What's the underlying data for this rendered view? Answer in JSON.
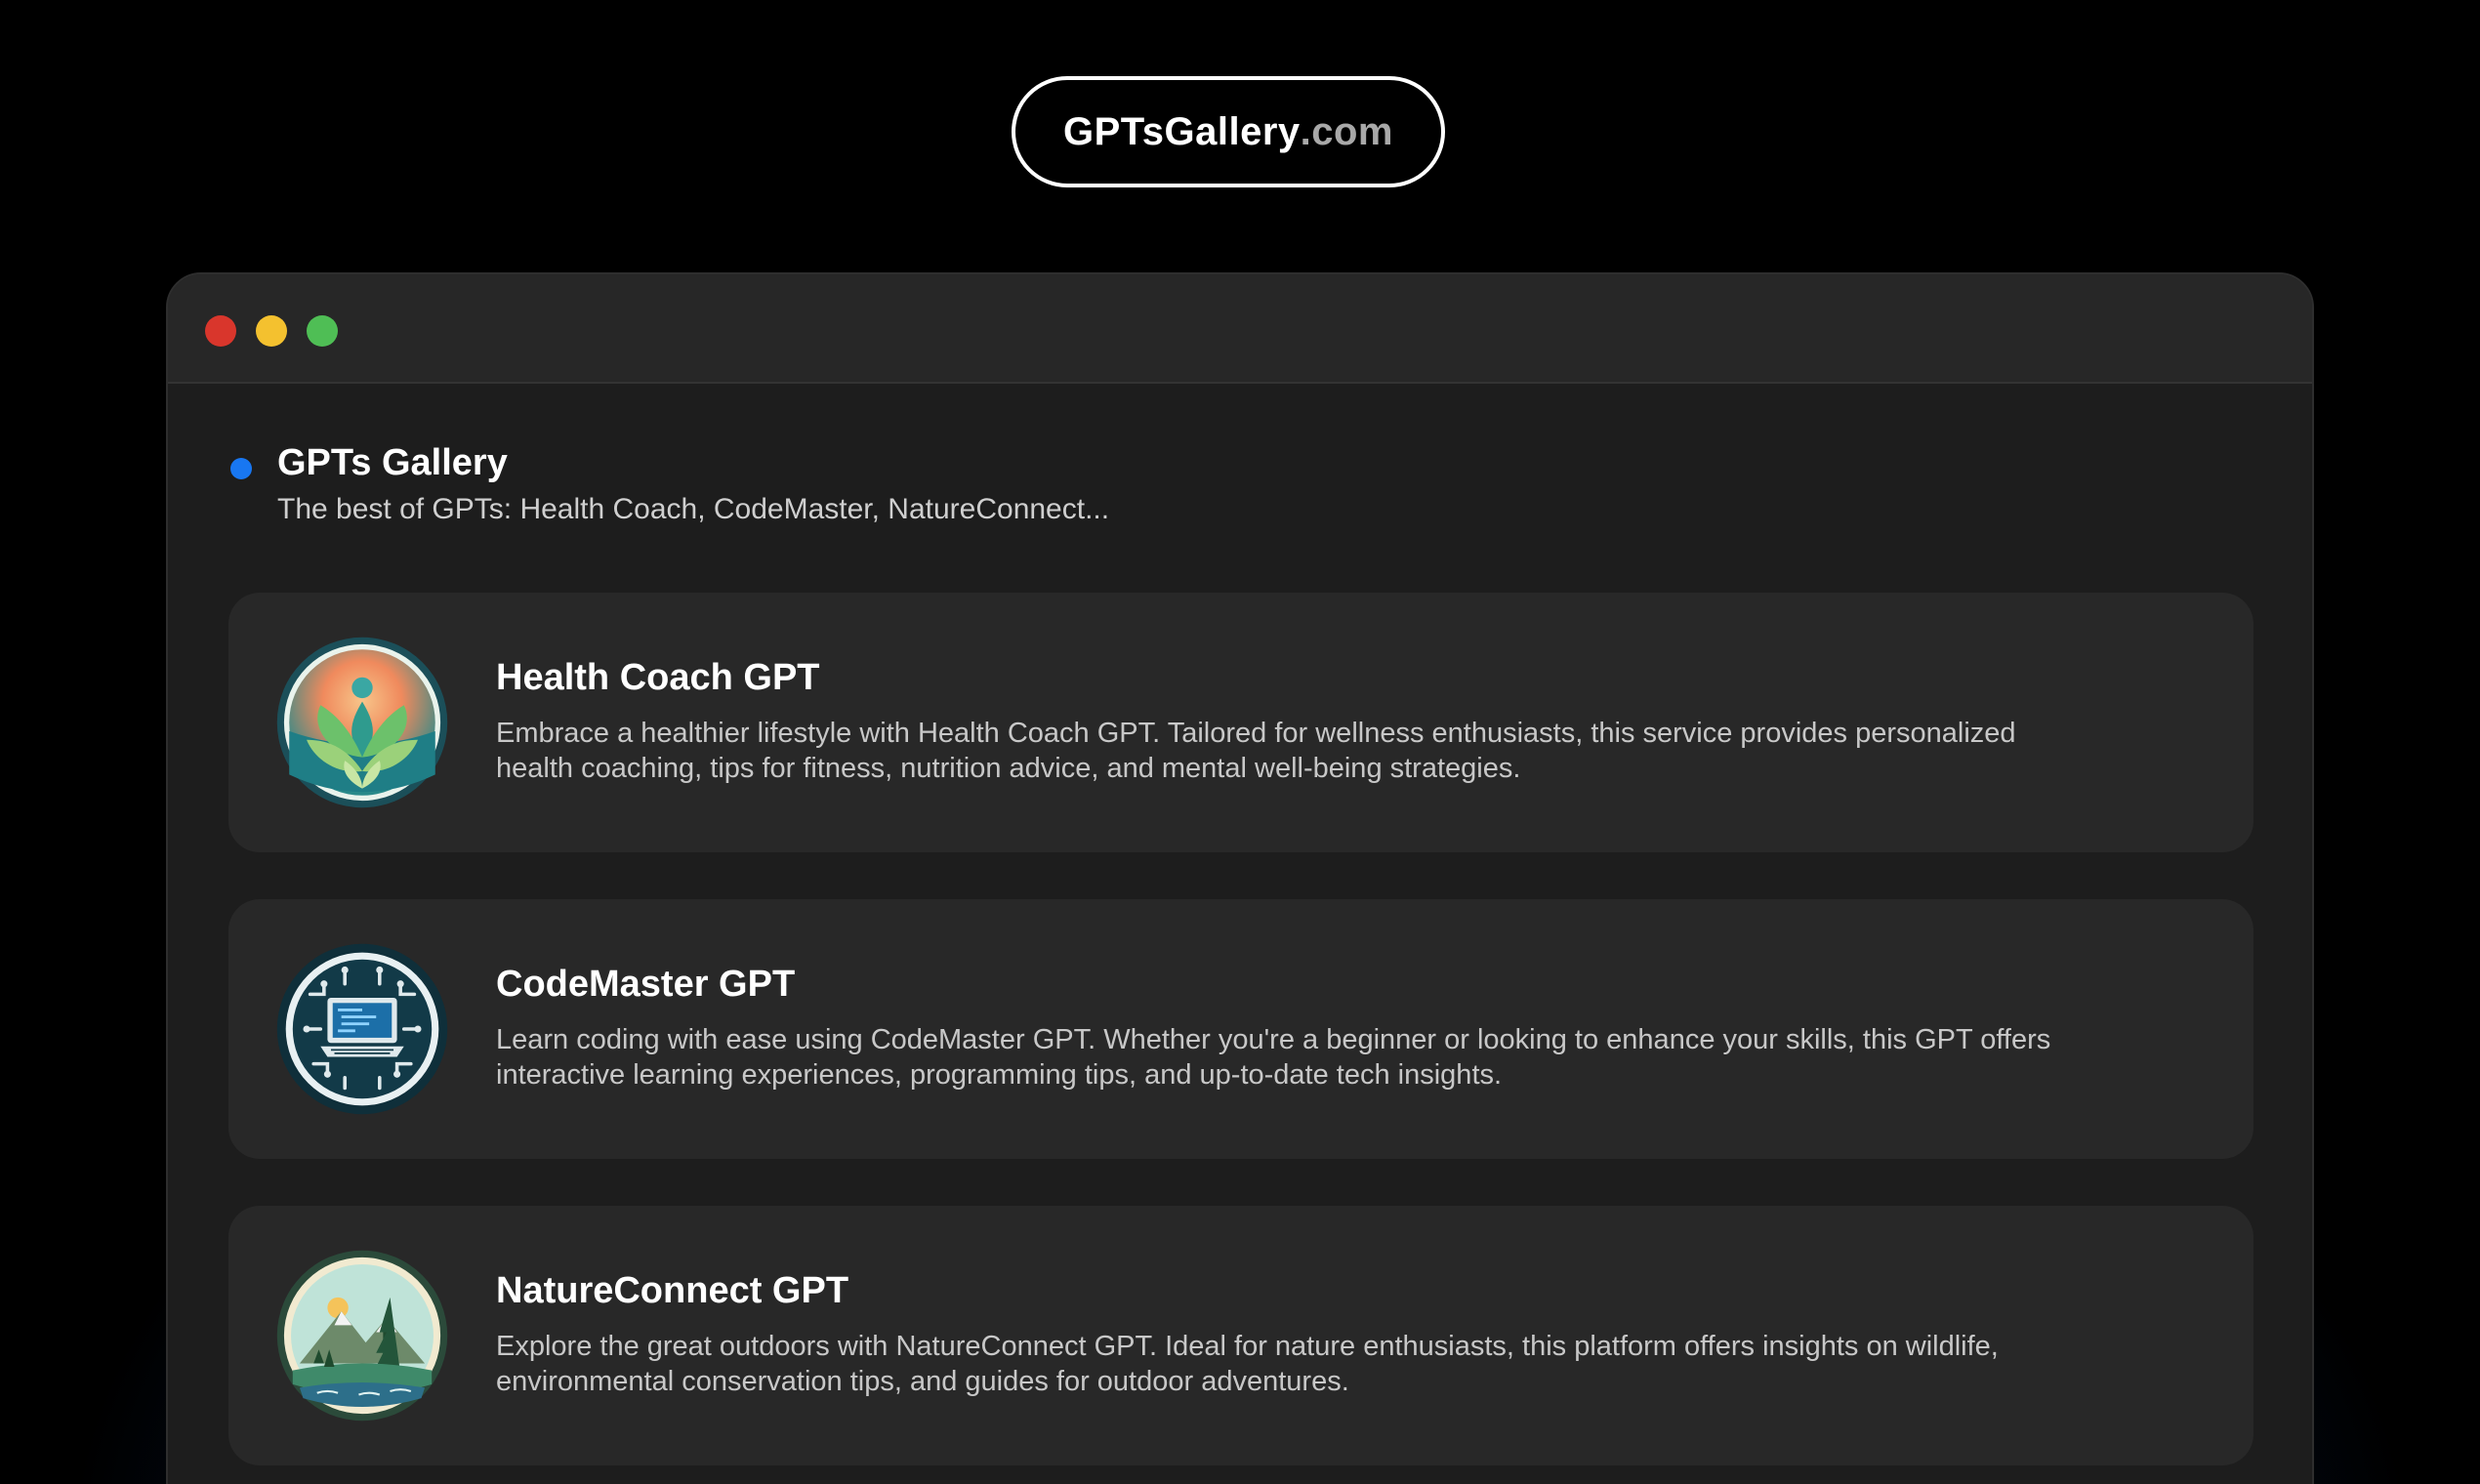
{
  "brand": {
    "name": "GPTsGallery",
    "tld": ".com"
  },
  "window": {
    "controls": [
      "close",
      "minimize",
      "maximize"
    ]
  },
  "header": {
    "title": "GPTs Gallery",
    "subtitle": "The best of GPTs: Health Coach, CodeMaster, NatureConnect..."
  },
  "cards": [
    {
      "title": "Health Coach GPT",
      "description": "Embrace a healthier lifestyle with Health Coach GPT. Tailored for wellness enthusiasts, this service provides personalized health coaching, tips for fitness, nutrition advice, and mental well-being strategies.",
      "icon": "wellness-lotus-icon"
    },
    {
      "title": "CodeMaster GPT",
      "description": "Learn coding with ease using CodeMaster GPT. Whether you're a beginner or looking to enhance your skills, this GPT offers interactive learning experiences, programming tips, and up-to-date tech insights.",
      "icon": "laptop-circuit-icon"
    },
    {
      "title": "NatureConnect GPT",
      "description": "Explore the great outdoors with NatureConnect GPT. Ideal for nature enthusiasts, this platform offers insights on wildlife, environmental conservation tips, and guides for outdoor adventures.",
      "icon": "mountain-forest-icon"
    }
  ],
  "colors": {
    "accent": "#1877f2",
    "close": "#d9362c",
    "minimize": "#f4c12f",
    "maximize": "#4fbe55"
  }
}
